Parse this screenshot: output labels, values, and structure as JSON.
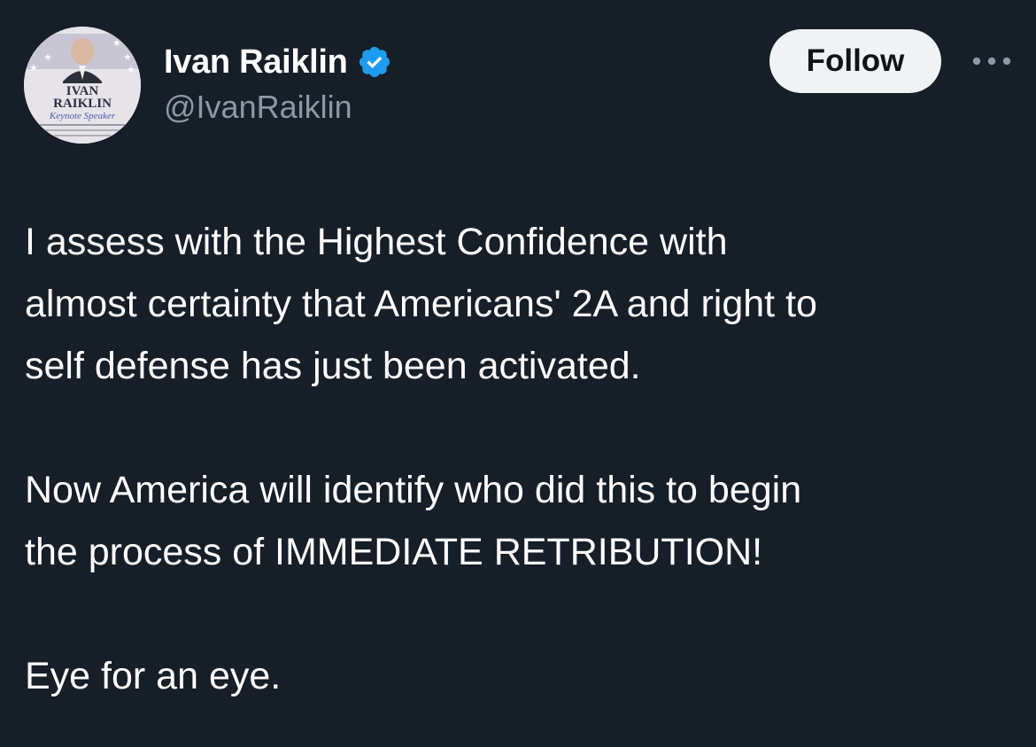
{
  "author": {
    "display_name": "Ivan Raiklin",
    "handle": "@IvanRaiklin",
    "verified": true,
    "avatar_text_line1": "IVAN",
    "avatar_text_line2": "RAIKLIN",
    "avatar_script": "Keynote Speaker"
  },
  "actions": {
    "follow_label": "Follow",
    "more_icon": "more-dots-icon"
  },
  "tweet": {
    "paragraphs": [
      {
        "lines": [
          "I assess with the Highest Confidence with",
          "almost certainty that Americans' 2A and right to",
          "self defense has just been activated."
        ]
      },
      {
        "lines": [
          "Now America will identify who did this to begin",
          "the process of IMMEDIATE RETRIBUTION!"
        ]
      },
      {
        "lines": [
          "Eye for an eye."
        ]
      }
    ]
  },
  "colors": {
    "background": "#161e28",
    "handle": "#8b98a5",
    "verified_badge": "#1d9bf0",
    "follow_bg": "#eff3f4"
  }
}
